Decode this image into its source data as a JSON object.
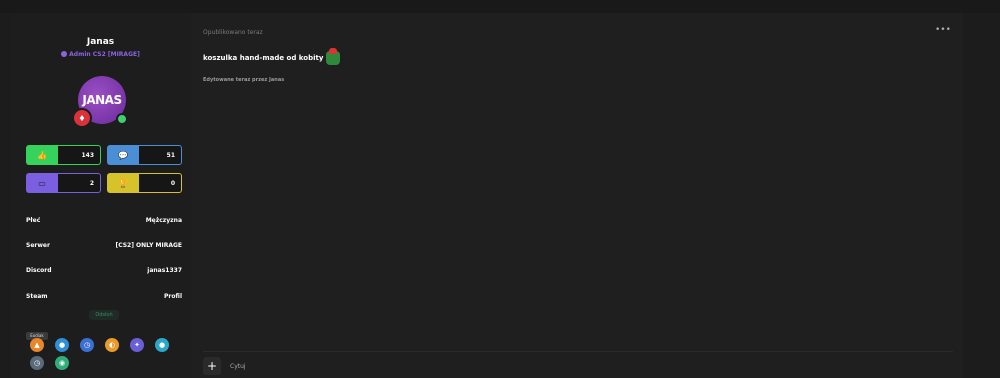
{
  "author": {
    "username": "Janas",
    "role": "Admin CS2 [MIRAGE]",
    "avatar_text": "JANAS",
    "stats": [
      {
        "icon": "thumbs-up-icon",
        "value": "143",
        "color": "#35d35c"
      },
      {
        "icon": "chat-bubbles-icon",
        "value": "51",
        "color": "#4a8fd6"
      },
      {
        "icon": "folder-icon",
        "value": "2",
        "color": "#7a5fe0"
      },
      {
        "icon": "trophy-icon",
        "value": "0",
        "color": "#d6c22a"
      }
    ],
    "info": [
      {
        "label": "Płeć",
        "value": "Mężczyzna"
      },
      {
        "label": "Serwer",
        "value": "[CS2] ONLY MIRAGE"
      },
      {
        "label": "Discord",
        "value": "janas1337"
      },
      {
        "label": "Steam",
        "value": "Profil"
      }
    ],
    "hide_label": "Odsłoń",
    "tooltip": "Eodiak",
    "trophies": [
      "#e8862a",
      "#2f8fd6",
      "#3a6fd6",
      "#e89a2a",
      "#6a5fd6",
      "#2aa8c8",
      "#5a6a7a",
      "#2fae7a"
    ]
  },
  "post": {
    "published": "Opublikowano teraz",
    "more": "•••",
    "title": "koszulka hand-made od kobity",
    "edited": "Edytowane teraz przez Janas",
    "plus": "+",
    "quote": "Cytuj"
  }
}
